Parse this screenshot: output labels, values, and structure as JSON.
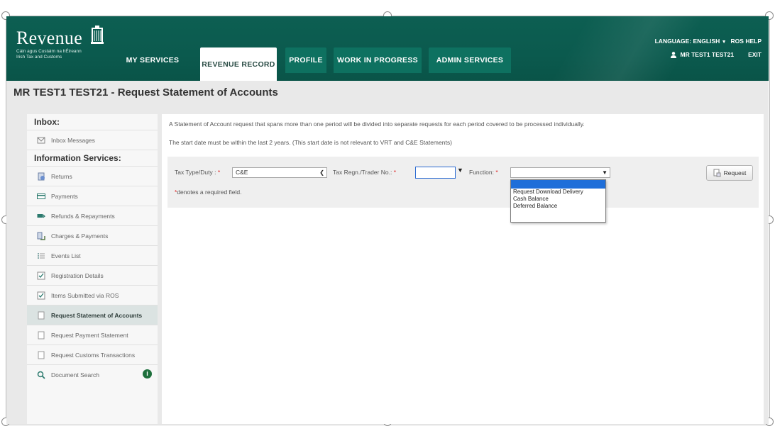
{
  "header": {
    "logo": {
      "word": "Revenue",
      "sub1": "Cáin agus Custaim na hÉireann",
      "sub2": "Irish Tax and Customs"
    },
    "tabs": [
      {
        "label": "MY SERVICES",
        "active": false
      },
      {
        "label": "REVENUE RECORD",
        "active": true
      },
      {
        "label": "PROFILE",
        "active": false
      },
      {
        "label": "WORK IN PROGRESS",
        "active": false
      },
      {
        "label": "ADMIN SERVICES",
        "active": false
      }
    ],
    "language_label": "LANGUAGE: ENGLISH",
    "ros_help": "ROS HELP",
    "user_name": "MR TEST1 TEST21",
    "exit": "EXIT"
  },
  "page_title": "MR TEST1 TEST21 - Request Statement of Accounts",
  "sidebar": {
    "inbox_heading": "Inbox:",
    "inbox_items": [
      {
        "label": "Inbox Messages",
        "icon": "envelope-icon"
      }
    ],
    "info_heading": "Information Services:",
    "info_items": [
      {
        "label": "Returns",
        "icon": "returns-icon"
      },
      {
        "label": "Payments",
        "icon": "card-icon"
      },
      {
        "label": "Refunds & Repayments",
        "icon": "refund-icon"
      },
      {
        "label": "Charges & Payments",
        "icon": "charges-icon"
      },
      {
        "label": "Events List",
        "icon": "list-icon"
      },
      {
        "label": "Registration Details",
        "icon": "checkbox-icon"
      },
      {
        "label": "Items Submitted via ROS",
        "icon": "checkbox-icon"
      },
      {
        "label": "Request Statement of Accounts",
        "icon": "document-icon",
        "selected": true
      },
      {
        "label": "Request Payment Statement",
        "icon": "document-icon"
      },
      {
        "label": "Request Customs Transactions",
        "icon": "document-icon"
      },
      {
        "label": "Document Search",
        "icon": "search-icon",
        "badge": "i"
      }
    ]
  },
  "main": {
    "info1": "A Statement of Account request that spans more than one period will be divided into separate requests for each period covered to be processed individually.",
    "info2": "The start date must be within the last 2 years. (This start date is not relevant to VRT and C&E Statements)",
    "form": {
      "tax_type_label": "Tax Type/Duty :",
      "tax_type_value": "C&E",
      "regn_label": "Tax Regn./Trader No.:",
      "regn_value": "",
      "function_label": "Function:",
      "function_value": "",
      "required_marker": "*",
      "required_note": "denotes a required field.",
      "request_button": "Request",
      "function_options": [
        "Request Download Delivery",
        "Cash Balance",
        "Deferred Balance"
      ]
    }
  },
  "colors": {
    "header_green": "#0b5a4e",
    "tab_green": "#0e7160",
    "highlight_blue": "#1e6ed9",
    "required_red": "#d22222"
  }
}
